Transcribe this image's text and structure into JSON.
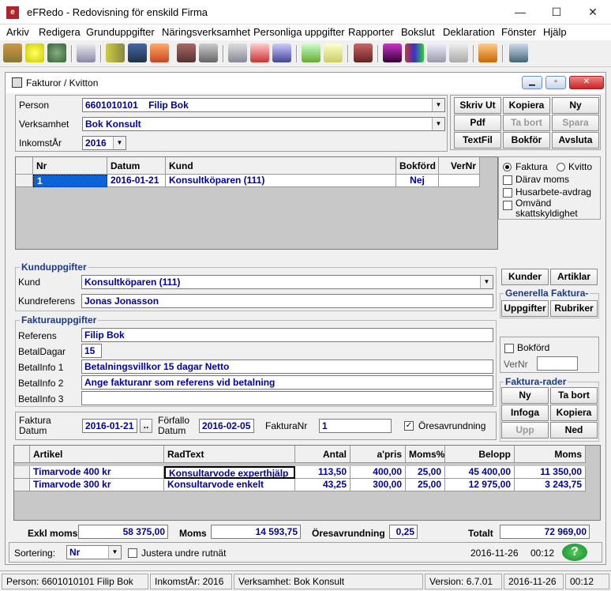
{
  "app": {
    "title": "eFRedo - Redovisning för enskild Firma",
    "min": "—",
    "max": "☐",
    "close": "✕"
  },
  "menu": [
    "Arkiv",
    "Redigera",
    "Grunduppgifter",
    "Näringsverksamhet",
    "Personliga uppgifter",
    "Rapporter",
    "Bokslut",
    "Deklaration",
    "Fönster",
    "Hjälp"
  ],
  "window": {
    "title": "Fakturor / Kvitton"
  },
  "form": {
    "person_label": "Person",
    "person_id": "6601010101",
    "person_name": "Filip Bok",
    "verksamhet_label": "Verksamhet",
    "verksamhet": "Bok Konsult",
    "inkomstar_label": "InkomstÅr",
    "inkomstar": "2016"
  },
  "buttons": {
    "skriv_ut": "Skriv Ut",
    "kopiera": "Kopiera",
    "ny": "Ny",
    "pdf": "Pdf",
    "ta_bort": "Ta bort",
    "spara": "Spara",
    "textfil": "TextFil",
    "bokfor": "Bokför",
    "avsluta": "Avsluta",
    "kunder": "Kunder",
    "artiklar": "Artiklar",
    "uppgifter": "Uppgifter",
    "rubriker": "Rubriker"
  },
  "invoice_list": {
    "headers": [
      "Nr",
      "Datum",
      "Kund",
      "Bokförd",
      "VerNr"
    ],
    "rows": [
      {
        "nr": "1",
        "datum": "2016-01-21",
        "kund": "Konsultköparen (111)",
        "bokford": "Nej",
        "vernr": ""
      }
    ]
  },
  "options": {
    "faktura": "Faktura",
    "kvitto": "Kvitto",
    "darav_moms": "Därav moms",
    "husarbete": "Husarbete-avdrag",
    "omvand1": "Omvänd",
    "omvand2": "skattskyldighet"
  },
  "kunduppgifter": {
    "title": "Kunduppgifter",
    "kund_label": "Kund",
    "kund": "Konsultköparen (111)",
    "kundref_label": "Kundreferens",
    "kundref": "Jonas Jonasson"
  },
  "generella": {
    "title": "Generella Faktura-"
  },
  "fakturauppgifter": {
    "title": "Fakturauppgifter",
    "referens_label": "Referens",
    "referens": "Filip Bok",
    "betaldagar_label": "BetalDagar",
    "betaldagar": "15",
    "betalinfo1_label": "BetalInfo 1",
    "betalinfo1": "Betalningsvillkor 15 dagar Netto",
    "betalinfo2_label": "BetalInfo 2",
    "betalinfo2": "Ange fakturanr som referens vid betalning",
    "betalinfo3_label": "BetalInfo 3",
    "betalinfo3": ""
  },
  "bokford_box": {
    "bokford": "Bokförd",
    "vernr": "VerNr"
  },
  "dates": {
    "faktura_l1": "Faktura",
    "faktura_l2": "Datum",
    "faktura_datum": "2016-01-21",
    "dots": "..",
    "forfallo_l1": "Förfallo",
    "forfallo_l2": "Datum",
    "forfallo_datum": "2016-02-05",
    "fakturanr_label": "FakturaNr",
    "fakturanr": "1",
    "oresavrundning": "Öresavrundning"
  },
  "faktura_rader": {
    "title": "Faktura-rader",
    "ny": "Ny",
    "ta_bort": "Ta bort",
    "infoga": "Infoga",
    "kopiera": "Kopiera",
    "upp": "Upp",
    "ned": "Ned"
  },
  "rows_grid": {
    "headers": [
      "Artikel",
      "RadText",
      "Antal",
      "a'pris",
      "Moms%",
      "Belopp",
      "Moms"
    ],
    "rows": [
      {
        "artikel": "Timarvode 400 kr",
        "radtext": "Konsultarvode experthjälp",
        "antal": "113,50",
        "apris": "400,00",
        "moms_pct": "25,00",
        "belopp": "45 400,00",
        "moms": "11 350,00"
      },
      {
        "artikel": "Timarvode 300 kr",
        "radtext": "Konsultarvode enkelt",
        "antal": "43,25",
        "apris": "300,00",
        "moms_pct": "25,00",
        "belopp": "12 975,00",
        "moms": "3 243,75"
      }
    ]
  },
  "totals": {
    "exkl_label": "Exkl moms",
    "exkl": "58 375,00",
    "moms_label": "Moms",
    "moms": "14 593,75",
    "ores_label": "Öresavrundning",
    "ores": "0,25",
    "totalt_label": "Totalt",
    "totalt": "72 969,00"
  },
  "bottom": {
    "sortering_label": "Sortering:",
    "sortering": "Nr",
    "justera": "Justera undre rutnät",
    "date": "2016-11-26",
    "time": "00:12",
    "help": "?"
  },
  "statusbar": {
    "person": "Person: 6601010101  Filip Bok",
    "inkomstar": "InkomstÅr: 2016",
    "verksamhet": "Verksamhet: Bok Konsult",
    "version": "Version: 6.7.01",
    "date": "2016-11-26",
    "time": "00:12"
  }
}
